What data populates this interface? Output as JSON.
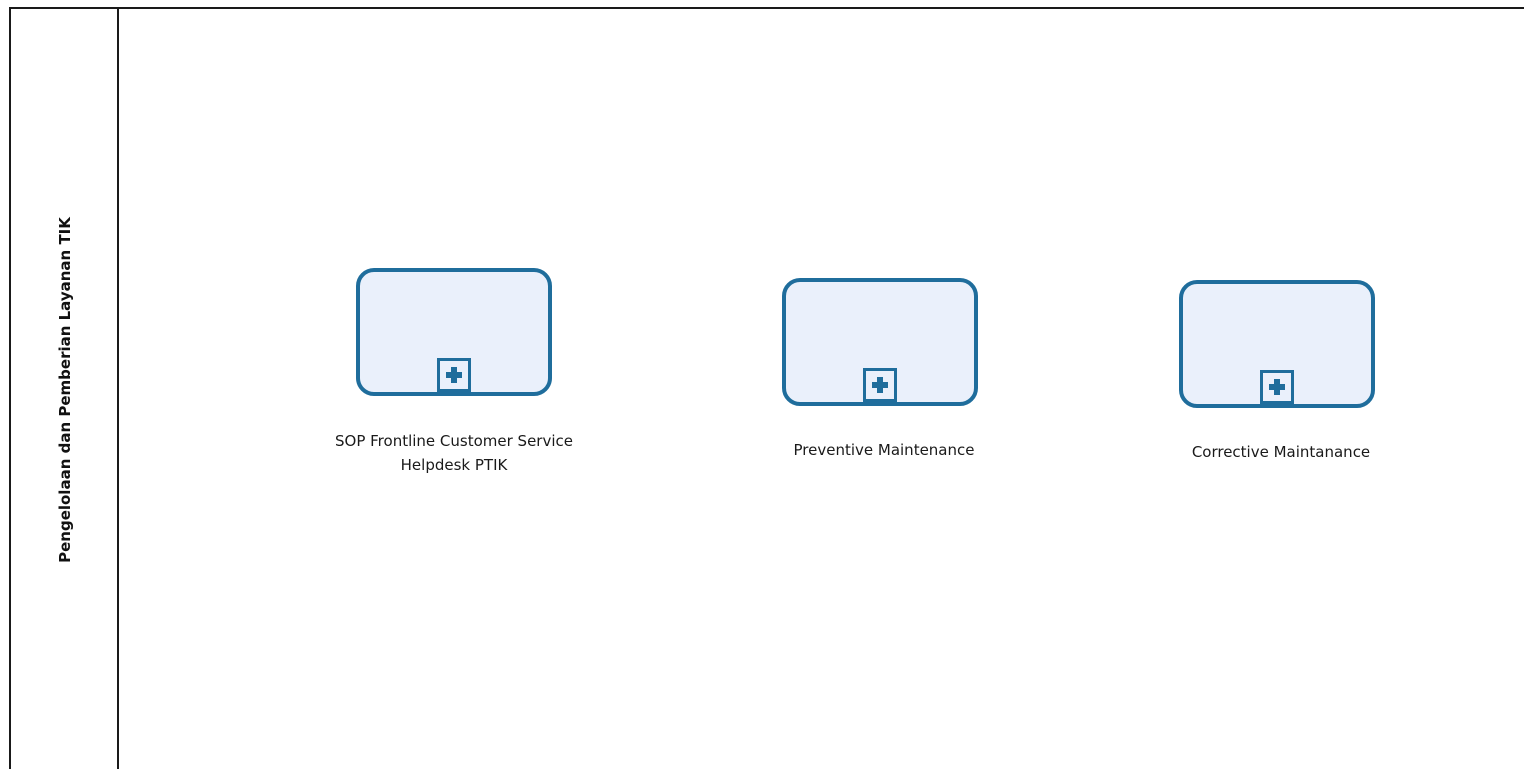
{
  "lane": {
    "title": "Pengelolaan dan Pemberian Layanan TIK"
  },
  "subprocesses": [
    {
      "label": "SOP Frontline Customer Service\nHelpdesk PTIK",
      "marker": "collapsed-subprocess-plus-icon"
    },
    {
      "label": "Preventive Maintenance",
      "marker": "collapsed-subprocess-plus-icon"
    },
    {
      "label": "Corrective Maintanance",
      "marker": "collapsed-subprocess-plus-icon"
    }
  ],
  "colors": {
    "task_border": "#1f6d9c",
    "task_fill": "#eaf0fb",
    "lane_border": "#1a1a1a"
  }
}
